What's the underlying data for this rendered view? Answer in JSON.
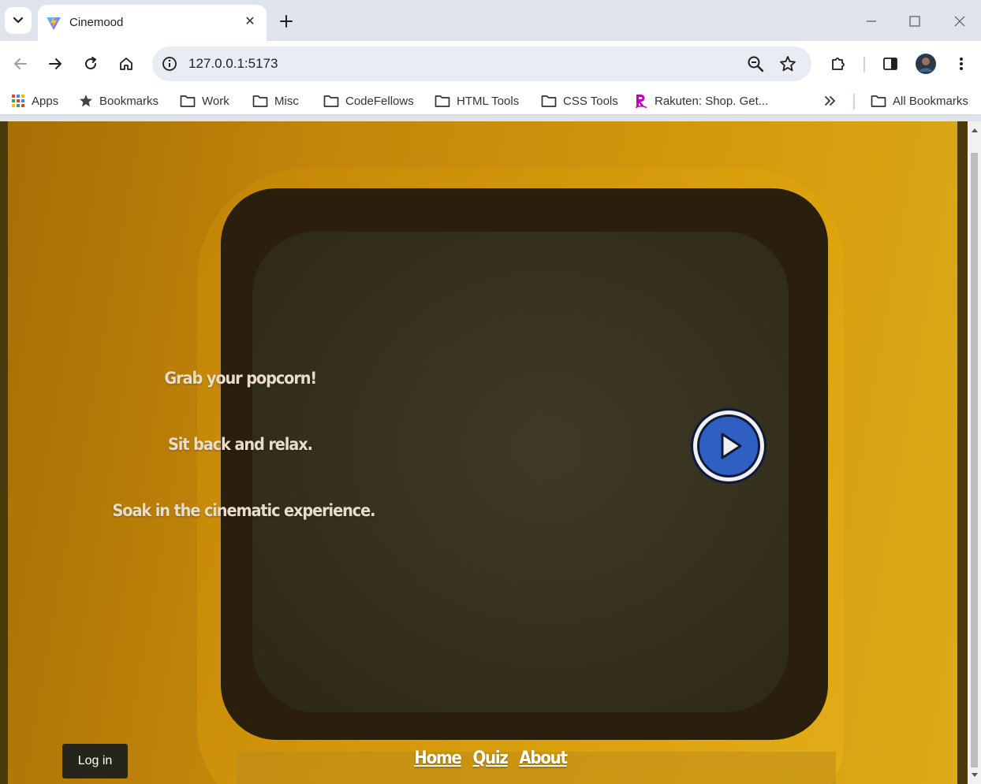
{
  "browser": {
    "tab_title": "Cinemood",
    "tab_close": "✕",
    "new_tab": "+",
    "url": "127.0.0.1:5173",
    "bookmarks": [
      {
        "label": "Apps",
        "icon": "apps-grid-icon"
      },
      {
        "label": "Bookmarks",
        "icon": "star-icon"
      },
      {
        "label": "Work",
        "icon": "folder-icon"
      },
      {
        "label": "Misc",
        "icon": "folder-icon"
      },
      {
        "label": "CodeFellows",
        "icon": "folder-icon"
      },
      {
        "label": "HTML Tools",
        "icon": "folder-icon"
      },
      {
        "label": "CSS Tools",
        "icon": "folder-icon"
      },
      {
        "label": "Rakuten: Shop. Get...",
        "icon": "rakuten-icon"
      }
    ],
    "all_bookmarks": "All Bookmarks",
    "colors": {
      "chrome_bg": "#dfe3eb",
      "accent": "#1a73e8"
    }
  },
  "page": {
    "taglines": [
      "Grab your popcorn!",
      "Sit back and relax.",
      "Soak in the cinematic experience."
    ],
    "play_button": "play-icon",
    "login_label": "Log in",
    "nav": [
      "Home",
      "Quiz",
      "About"
    ],
    "colors": {
      "background": "#d49c0d",
      "play_blue": "#2f5fc0",
      "text": "#e9dcc9"
    }
  }
}
